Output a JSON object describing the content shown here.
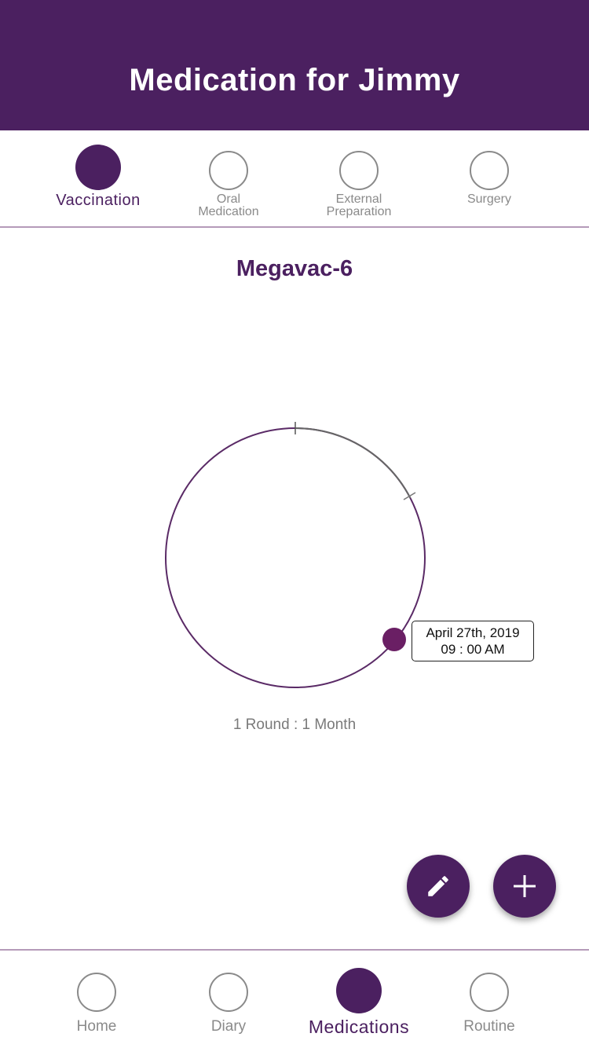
{
  "header": {
    "title": "Medication for Jimmy"
  },
  "categories": [
    {
      "label": "Vaccination",
      "active": true
    },
    {
      "label_line1": "Oral",
      "label_line2": "Medication",
      "active": false
    },
    {
      "label_line1": "External",
      "label_line2": "Preparation",
      "active": false
    },
    {
      "label": "Surgery",
      "active": false
    }
  ],
  "medication": {
    "name": "Megavac-6",
    "schedule": {
      "round_text": "1 Round : 1 Month",
      "dose_progress": 0.375,
      "dose_date": "April 27th, 2019",
      "dose_time": "09 : 00 AM"
    }
  },
  "fab": {
    "edit_icon": "pencil-icon",
    "add_icon": "plus-icon"
  },
  "bottom_nav": [
    {
      "label": "Home",
      "active": false
    },
    {
      "label": "Diary",
      "active": false
    },
    {
      "label": "Medications",
      "active": true
    },
    {
      "label": "Routine",
      "active": false
    }
  ],
  "colors": {
    "primary": "#4b2060",
    "accent_dot": "#6a1f64",
    "inactive": "#8a8a8a"
  }
}
